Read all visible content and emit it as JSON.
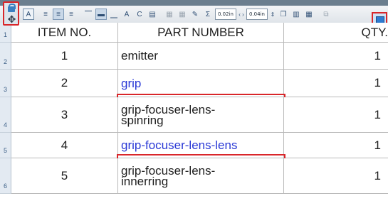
{
  "toolbar": {
    "row_height_value": "0.02in",
    "column_width_value": "0.04in",
    "sum_symbol": "Σ",
    "swap_symbol": "‹ ›"
  },
  "table": {
    "headers": {
      "item_no": "ITEM NO.",
      "part_number": "PART NUMBER",
      "qty": "QTY."
    },
    "header_row_number": "1",
    "rows": [
      {
        "row_number": "2",
        "item_no": "1",
        "part_line1": "emitter",
        "part_line2": "",
        "qty": "1",
        "link": false,
        "highlighted": false
      },
      {
        "row_number": "3",
        "item_no": "2",
        "part_line1": "grip",
        "part_line2": "",
        "qty": "1",
        "link": true,
        "highlighted": true
      },
      {
        "row_number": "4",
        "item_no": "3",
        "part_line1": "grip-focuser-lens-",
        "part_line2": "spinring",
        "qty": "1",
        "link": false,
        "highlighted": false
      },
      {
        "row_number": "5",
        "item_no": "4",
        "part_line1": "grip-focuser-lens-lens",
        "part_line2": "",
        "qty": "1",
        "link": true,
        "highlighted": true
      },
      {
        "row_number": "6",
        "item_no": "5",
        "part_line1": "grip-focuser-lens-",
        "part_line2": "innerring",
        "qty": "1",
        "link": false,
        "highlighted": false
      }
    ]
  },
  "colors": {
    "highlight_border": "#d9262a",
    "link_text": "#2a39d6",
    "row_header_bg": "#e3eaf2"
  },
  "icons": {
    "lock": "lock-icon",
    "move": "move-icon",
    "table_options": "table-options-icon"
  }
}
